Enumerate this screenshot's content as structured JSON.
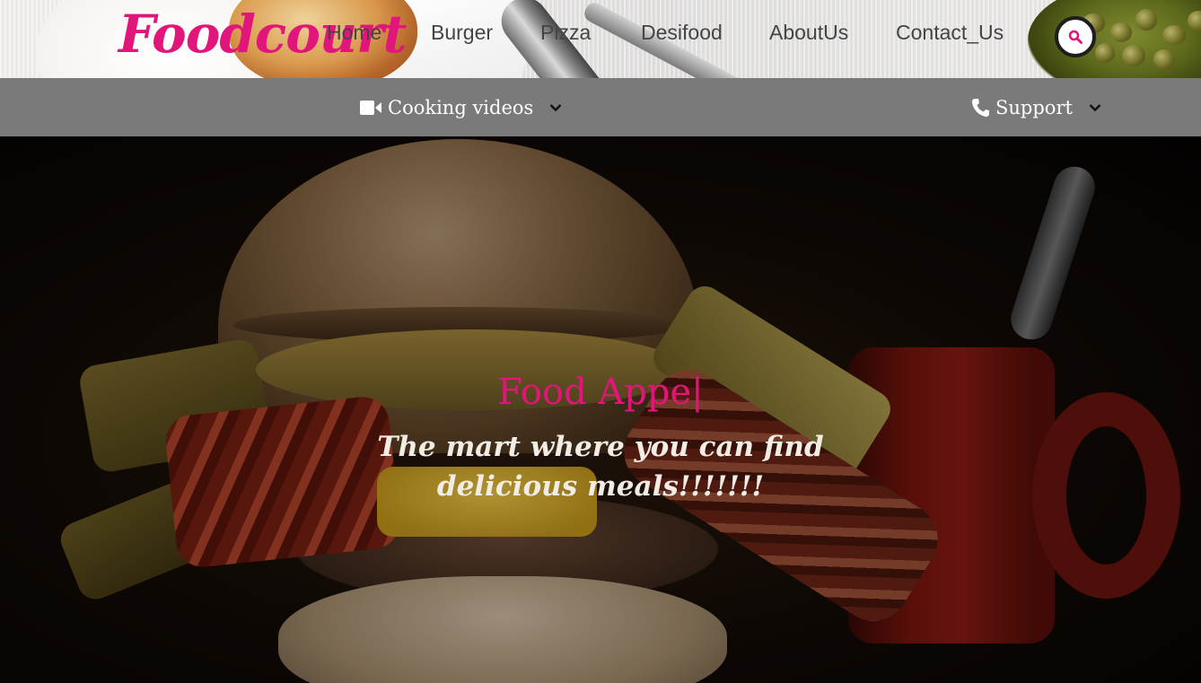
{
  "brand": {
    "name": "Foodcourt",
    "accent_color": "#e2157a"
  },
  "nav": {
    "items": [
      {
        "label": "Home"
      },
      {
        "label": "Burger"
      },
      {
        "label": "Pizza"
      },
      {
        "label": "Desifood"
      },
      {
        "label": "AboutUs"
      },
      {
        "label": "Contact_Us"
      }
    ],
    "search_icon": "search-icon"
  },
  "subnav": {
    "cooking": {
      "label": "Cooking videos",
      "icon": "video-camera-icon",
      "chevron": "chevron-down-icon"
    },
    "support": {
      "label": "Support",
      "icon": "phone-icon",
      "chevron": "chevron-down-icon"
    },
    "background": "#7a7a7a"
  },
  "hero": {
    "title": "Food Appe",
    "cursor": "|",
    "subtitle_line1": "The mart where you can find",
    "subtitle_line2": "delicious meals!!!!!!!"
  }
}
